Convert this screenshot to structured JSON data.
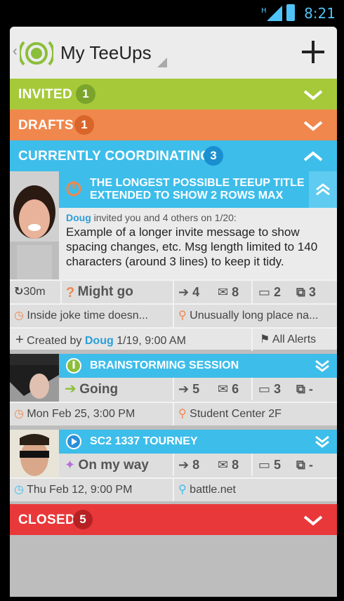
{
  "status_bar": {
    "time": "8:21",
    "network": "H"
  },
  "header": {
    "title": "My TeeUps"
  },
  "sections": {
    "invited": {
      "label": "INVITED",
      "count": "1"
    },
    "drafts": {
      "label": "DRAFTS",
      "count": "1"
    },
    "coordinating": {
      "label": "CURRENTLY COORDINATING",
      "count": "3"
    },
    "closed": {
      "label": "CLOSED",
      "count": "5"
    }
  },
  "teeups": [
    {
      "title": "THE LONGEST POSSIBLE TEEUP TITLE EXTENDED TO SHOW 2 ROWS MAX",
      "inviter": "Doug",
      "invite_text": "invited you and 4 others on 1/20:",
      "message": "Example of a longer invite message to show spacing changes, etc. Msg length limited to 140 characters (around 3 lines) to keep it tidy.",
      "timer": "30m",
      "status": "Might go",
      "going": "4",
      "invited": "8",
      "comments": "2",
      "suggestions": "3",
      "when": "Inside joke time doesn...",
      "where": "Unusually long place na...",
      "created_prefix": "Created by",
      "created_by": "Doug",
      "created_date": "1/19, 9:00 AM",
      "alerts": "All Alerts"
    },
    {
      "title": "BRAINSTORMING SESSION",
      "status": "Going",
      "going": "5",
      "invited": "6",
      "comments": "3",
      "suggestions": "-",
      "when": "Mon Feb 25, 3:00 PM",
      "where": "Student Center 2F"
    },
    {
      "title": "SC2 1337 TOURNEY",
      "status": "On my way",
      "going": "8",
      "invited": "8",
      "comments": "5",
      "suggestions": "-",
      "when": "Thu Feb 12, 9:00 PM",
      "where": "battle.net"
    }
  ],
  "colors": {
    "invited": "#a6c93a",
    "drafts": "#f0874d",
    "coordinating": "#3dbdea",
    "closed": "#e9383a",
    "orange_accent": "#f0874d",
    "blue_accent": "#3dbdea"
  },
  "icons": [
    "logo-icon",
    "plus-icon",
    "chevron-down-icon",
    "chevron-up-icon",
    "power-icon",
    "arrow-icon",
    "envelope-icon",
    "comment-icon",
    "suggestion-icon",
    "clock-icon",
    "pin-icon",
    "flag-icon",
    "timer-icon",
    "question-icon",
    "walker-icon"
  ]
}
